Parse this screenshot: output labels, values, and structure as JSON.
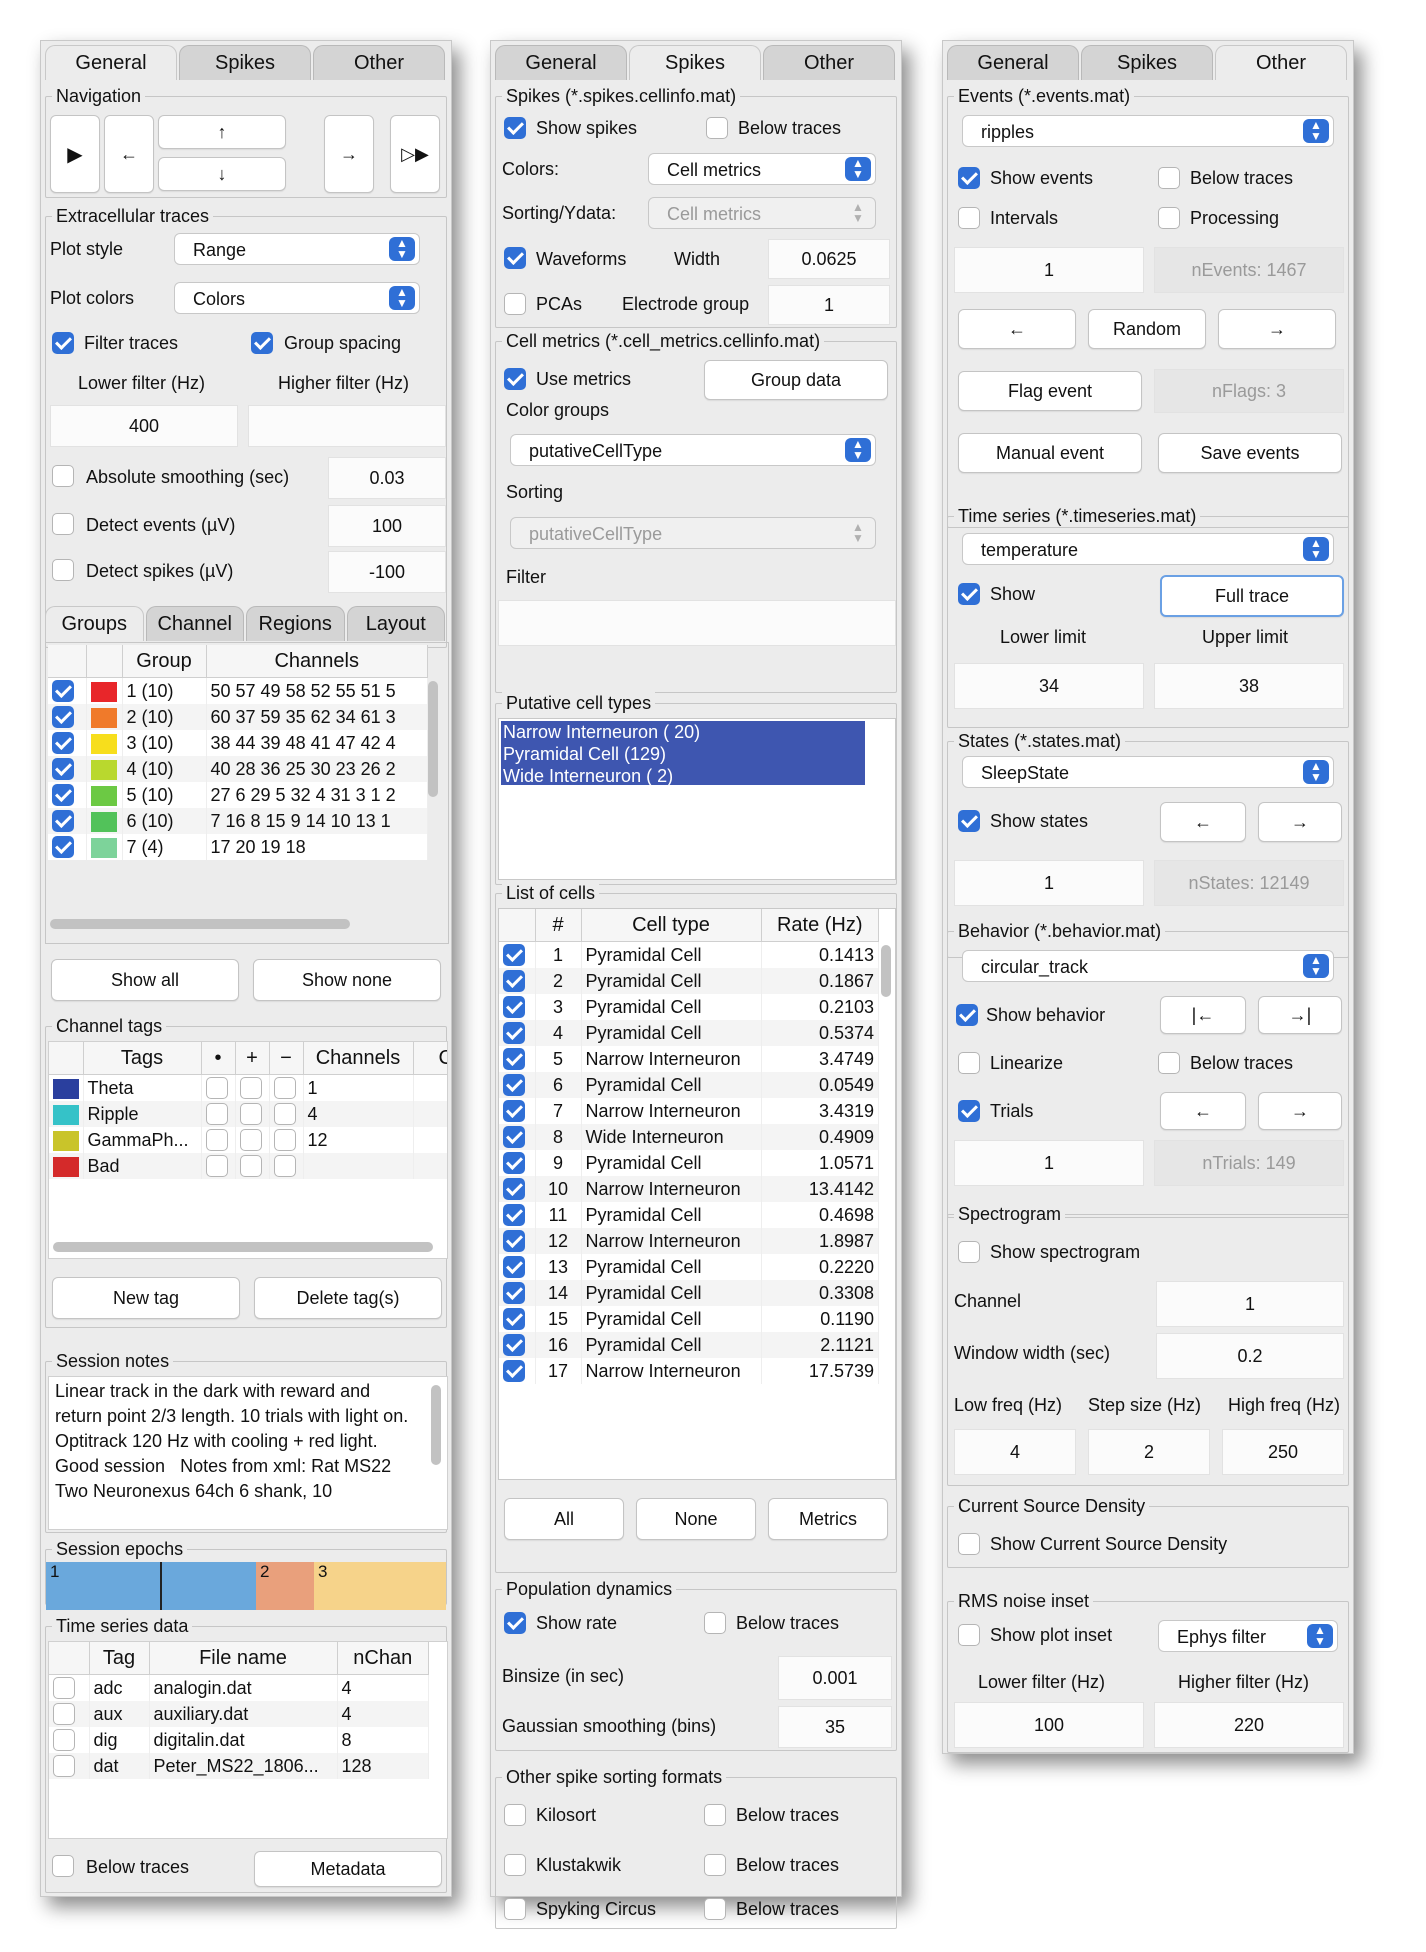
{
  "tabs": [
    "General",
    "Spikes",
    "Other"
  ],
  "general": {
    "navigation": {
      "title": "Navigation",
      "play": "▶",
      "left": "←",
      "up": "↑",
      "down": "↓",
      "right": "→",
      "fast": "▷▶"
    },
    "extracellular": {
      "title": "Extracellular traces",
      "plot_style_label": "Plot style",
      "plot_style_value": "Range",
      "plot_colors_label": "Plot colors",
      "plot_colors_value": "Colors",
      "filter_traces": "Filter traces",
      "group_spacing": "Group spacing",
      "lower_filter": "Lower filter (Hz)",
      "higher_filter": "Higher filter (Hz)",
      "lower_value": "400",
      "higher_value": "",
      "abs_smoothing": "Absolute smoothing (sec)",
      "abs_smoothing_value": "0.03",
      "detect_events": "Detect events (µV)",
      "detect_events_value": "100",
      "detect_spikes": "Detect spikes (µV)",
      "detect_spikes_value": "-100"
    },
    "subtabs": [
      "Groups",
      "Channel",
      "Regions",
      "Layout"
    ],
    "groups_table": {
      "headers": [
        "Group",
        "Channels"
      ],
      "rows": [
        {
          "group": "1 (10)",
          "channels": "50 57 49 58 52 55 51 5",
          "color": "#e8262a"
        },
        {
          "group": "2 (10)",
          "channels": "60 37 59 35 62 34 61 3",
          "color": "#f07a2a"
        },
        {
          "group": "3 (10)",
          "channels": "38 44 39 48 41 47 42 4",
          "color": "#f7de1c"
        },
        {
          "group": "4 (10)",
          "channels": "40 28 36 25 30 23 26 2",
          "color": "#b9d82e"
        },
        {
          "group": "5 (10)",
          "channels": "27 6 29 5 32 4 31 3 1 2",
          "color": "#6cc944"
        },
        {
          "group": "6 (10)",
          "channels": "7 16 8 15 9 14 10 13 1",
          "color": "#52c25a"
        },
        {
          "group": "7 (4)",
          "channels": "17 20 19 18",
          "color": "#7dd39a"
        }
      ]
    },
    "show_all": "Show all",
    "show_none": "Show none",
    "channel_tags": {
      "title": "Channel tags",
      "headers": [
        "Tags",
        "•",
        "+",
        "−",
        "Channels",
        "C"
      ],
      "rows": [
        {
          "tag": "Theta",
          "channels": "1",
          "color": "#2a3f9e"
        },
        {
          "tag": "Ripple",
          "channels": "4",
          "color": "#35c2c8"
        },
        {
          "tag": "GammaPh...",
          "channels": "12",
          "color": "#c9c42a"
        },
        {
          "tag": "Bad",
          "channels": "",
          "color": "#d42a2a"
        }
      ],
      "new_tag": "New tag",
      "delete_tag": "Delete tag(s)"
    },
    "session_notes": {
      "title": "Session notes",
      "text": "Linear track in the dark with reward and return point 2/3 length. 10 trials with light on. Optitrack 120 Hz with cooling + red light. Good session   Notes from xml: Rat MS22\nTwo Neuronexus 64ch 6 shank, 10"
    },
    "session_epochs": {
      "title": "Session epochs",
      "labels": [
        "1",
        "2",
        "3"
      ],
      "colors": [
        "#6aa8dc",
        "#e9a07c",
        "#f6d38a"
      ]
    },
    "time_series": {
      "title": "Time series data",
      "headers": [
        "Tag",
        "File name",
        "nChan"
      ],
      "rows": [
        {
          "tag": "adc",
          "file": "analogin.dat",
          "nchan": "4"
        },
        {
          "tag": "aux",
          "file": "auxiliary.dat",
          "nchan": "4"
        },
        {
          "tag": "dig",
          "file": "digitalin.dat",
          "nchan": "8"
        },
        {
          "tag": "dat",
          "file": "Peter_MS22_1806...",
          "nchan": "128"
        }
      ],
      "below_traces": "Below traces",
      "metadata": "Metadata"
    }
  },
  "spikes": {
    "spikes_group": {
      "title": "Spikes  (*.spikes.cellinfo.mat)",
      "show_spikes": "Show spikes",
      "below_traces": "Below traces",
      "colors_label": "Colors:",
      "colors_value": "Cell metrics",
      "sorting_label": "Sorting/Ydata:",
      "sorting_value": "Cell metrics",
      "waveforms": "Waveforms",
      "width_label": "Width",
      "width_value": "0.0625",
      "pcas": "PCAs",
      "electrode_label": "Electrode group",
      "electrode_value": "1"
    },
    "cell_metrics": {
      "title": "Cell metrics (*.cell_metrics.cellinfo.mat)",
      "use_metrics": "Use metrics",
      "group_data": "Group data",
      "color_groups": "Color groups",
      "color_groups_value": "putativeCellType",
      "sorting": "Sorting",
      "sorting_value": "putativeCellType",
      "filter": "Filter"
    },
    "putative": {
      "title": "Putative cell types",
      "items": [
        "Narrow Interneuron ( 20)",
        "Pyramidal Cell (129)",
        "Wide Interneuron (  2)"
      ]
    },
    "cells": {
      "title": "List of cells",
      "headers": [
        "#",
        "Cell type",
        "Rate (Hz)"
      ],
      "rows": [
        {
          "n": "1",
          "type": "Pyramidal Cell",
          "rate": "0.1413"
        },
        {
          "n": "2",
          "type": "Pyramidal Cell",
          "rate": "0.1867"
        },
        {
          "n": "3",
          "type": "Pyramidal Cell",
          "rate": "0.2103"
        },
        {
          "n": "4",
          "type": "Pyramidal Cell",
          "rate": "0.5374"
        },
        {
          "n": "5",
          "type": "Narrow Interneuron",
          "rate": "3.4749"
        },
        {
          "n": "6",
          "type": "Pyramidal Cell",
          "rate": "0.0549"
        },
        {
          "n": "7",
          "type": "Narrow Interneuron",
          "rate": "3.4319"
        },
        {
          "n": "8",
          "type": "Wide Interneuron",
          "rate": "0.4909"
        },
        {
          "n": "9",
          "type": "Pyramidal Cell",
          "rate": "1.0571"
        },
        {
          "n": "10",
          "type": "Narrow Interneuron",
          "rate": "13.4142"
        },
        {
          "n": "11",
          "type": "Pyramidal Cell",
          "rate": "0.4698"
        },
        {
          "n": "12",
          "type": "Narrow Interneuron",
          "rate": "1.8987"
        },
        {
          "n": "13",
          "type": "Pyramidal Cell",
          "rate": "0.2220"
        },
        {
          "n": "14",
          "type": "Pyramidal Cell",
          "rate": "0.3308"
        },
        {
          "n": "15",
          "type": "Pyramidal Cell",
          "rate": "0.1190"
        },
        {
          "n": "16",
          "type": "Pyramidal Cell",
          "rate": "2.1121"
        },
        {
          "n": "17",
          "type": "Narrow Interneuron",
          "rate": "17.5739"
        }
      ],
      "all": "All",
      "none": "None",
      "metrics": "Metrics"
    },
    "population": {
      "title": "Population dynamics",
      "show_rate": "Show rate",
      "below_traces": "Below traces",
      "binsize_label": "Binsize (in sec)",
      "binsize_value": "0.001",
      "gauss_label": "Gaussian smoothing (bins)",
      "gauss_value": "35"
    },
    "other_formats": {
      "title": "Other spike sorting formats",
      "items": [
        "Kilosort",
        "Klustakwik",
        "Spyking Circus"
      ],
      "below_traces": "Below traces"
    }
  },
  "other": {
    "events": {
      "title": "Events (*.events.mat)",
      "popup": "ripples",
      "show_events": "Show events",
      "below_traces": "Below traces",
      "intervals": "Intervals",
      "processing": "Processing",
      "event_value": "1",
      "n_events": "nEvents: 1467",
      "left": "←",
      "random": "Random",
      "right": "→",
      "flag_event": "Flag event",
      "n_flags": "nFlags: 3",
      "manual_event": "Manual event",
      "save_events": "Save events"
    },
    "timeseries": {
      "title": "Time series (*.timeseries.mat)",
      "popup": "temperature",
      "show": "Show",
      "full_trace": "Full trace",
      "lower_limit": "Lower limit",
      "upper_limit": "Upper limit",
      "lower_value": "34",
      "upper_value": "38"
    },
    "states": {
      "title": "States (*.states.mat)",
      "popup": "SleepState",
      "show_states": "Show states",
      "left": "←",
      "right": "→",
      "state_value": "1",
      "n_states": "nStates: 12149"
    },
    "behavior": {
      "title": "Behavior (*.behavior.mat)",
      "popup": "circular_track",
      "show_behavior": "Show behavior",
      "start": "|←",
      "end": "→|",
      "linearize": "Linearize",
      "below_traces": "Below traces",
      "trials": "Trials",
      "left": "←",
      "right": "→",
      "trial_value": "1",
      "n_trials": "nTrials: 149"
    },
    "spectrogram": {
      "title": "Spectrogram",
      "show": "Show spectrogram",
      "channel_label": "Channel",
      "channel_value": "1",
      "window_label": "Window width (sec)",
      "window_value": "0.2",
      "low_label": "Low freq (Hz)",
      "step_label": "Step size (Hz)",
      "high_label": "High freq (Hz)",
      "low_value": "4",
      "step_value": "2",
      "high_value": "250"
    },
    "csd": {
      "title": "Current Source Density",
      "show": "Show Current Source Density"
    },
    "rms": {
      "title": "RMS noise inset",
      "show": "Show plot inset",
      "popup": "Ephys filter",
      "lower_label": "Lower filter (Hz)",
      "higher_label": "Higher filter (Hz)",
      "lower_value": "100",
      "higher_value": "220"
    }
  }
}
